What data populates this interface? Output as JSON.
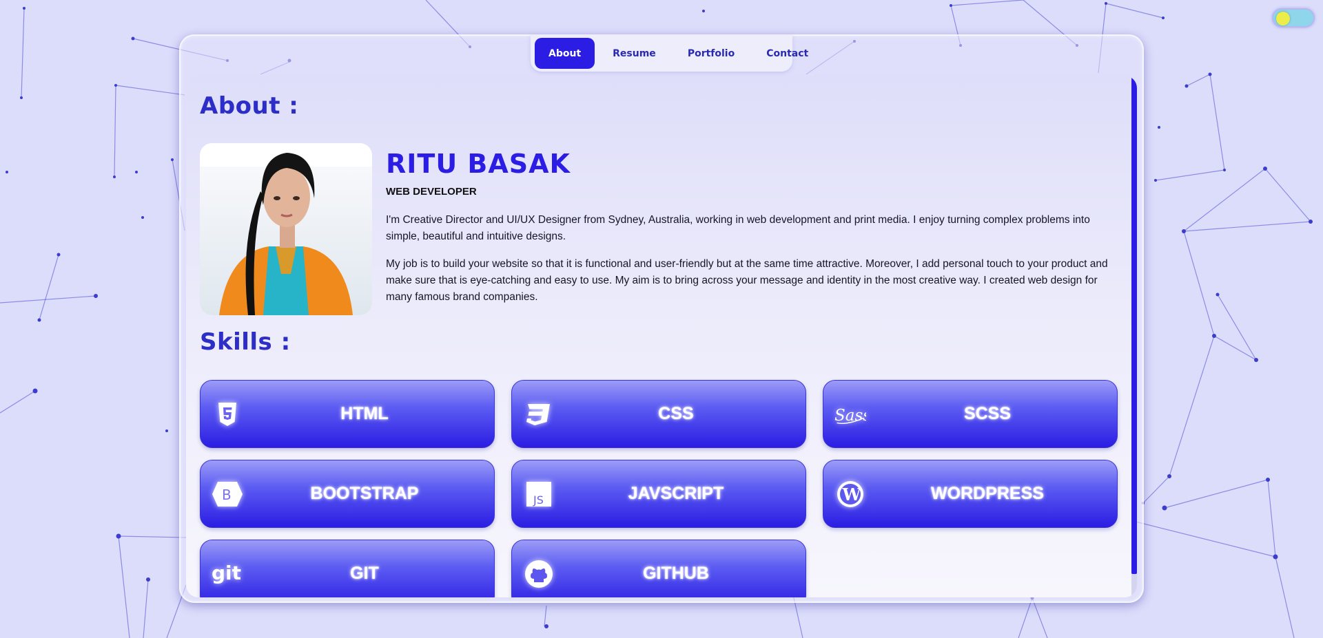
{
  "theme_toggle": {
    "state": "light"
  },
  "nav": {
    "items": [
      {
        "label": "About",
        "active": true
      },
      {
        "label": "Resume",
        "active": false
      },
      {
        "label": "Portfolio",
        "active": false
      },
      {
        "label": "Contact",
        "active": false
      }
    ]
  },
  "about": {
    "title": "About :",
    "name": "RITU BASAK",
    "role": "WEB DEVELOPER",
    "bio": [
      "I'm Creative Director and UI/UX Designer from Sydney, Australia, working in web development and print media. I enjoy turning complex problems into simple, beautiful and intuitive designs.",
      "My job is to build your website so that it is functional and user-friendly but at the same time attractive. Moreover, I add personal touch to your product and make sure that is eye-catching and easy to use. My aim is to bring across your message and identity in the most creative way. I created web design for many famous brand companies."
    ]
  },
  "skills": {
    "title": "Skills :",
    "items": [
      {
        "label": "HTML",
        "icon": "html5-icon"
      },
      {
        "label": "CSS",
        "icon": "css3-icon"
      },
      {
        "label": "SCSS",
        "icon": "sass-icon"
      },
      {
        "label": "BOOTSTRAP",
        "icon": "bootstrap-icon"
      },
      {
        "label": "JAVSCRIPT",
        "icon": "javascript-icon"
      },
      {
        "label": "WORDPRESS",
        "icon": "wordpress-icon"
      },
      {
        "label": "GIT",
        "icon": "git-icon"
      },
      {
        "label": "GITHUB",
        "icon": "github-icon"
      }
    ]
  },
  "colors": {
    "accent": "#2b1de3",
    "background": "#dcdcfb",
    "heading": "#2d2dc8"
  }
}
